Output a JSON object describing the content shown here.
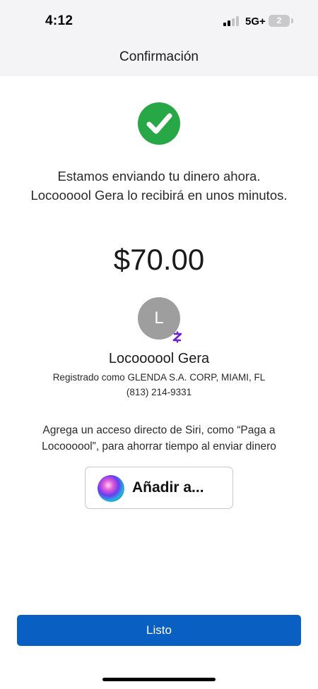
{
  "status_bar": {
    "time": "4:12",
    "network": "5G+",
    "battery_level": "2",
    "signal_bars_active": 2,
    "signal_bars_total": 4
  },
  "header": {
    "title": "Confirmación"
  },
  "confirmation": {
    "icon": "check-circle-icon",
    "icon_color": "#27a745",
    "message": "Estamos enviando tu dinero ahora. Locoooool Gera lo recibirá en unos minutos.",
    "amount": "$70.00"
  },
  "recipient": {
    "initial": "L",
    "avatar_color": "#9e9e9e",
    "badge_icon": "zelle-icon",
    "badge_color": "#6d1ed4",
    "name": "Locoooool Gera",
    "registered": "Registrado como GLENDA S.A. CORP, MIAMI, FL",
    "phone": "(813) 214-9331"
  },
  "siri": {
    "description": "Agrega un acceso directo de Siri, como “Paga a Locoooool”, para ahorrar tiempo al enviar dinero",
    "button_label": "Añadir a...",
    "icon": "siri-icon"
  },
  "footer": {
    "done_label": "Listo",
    "accent_color": "#0a60c2"
  }
}
